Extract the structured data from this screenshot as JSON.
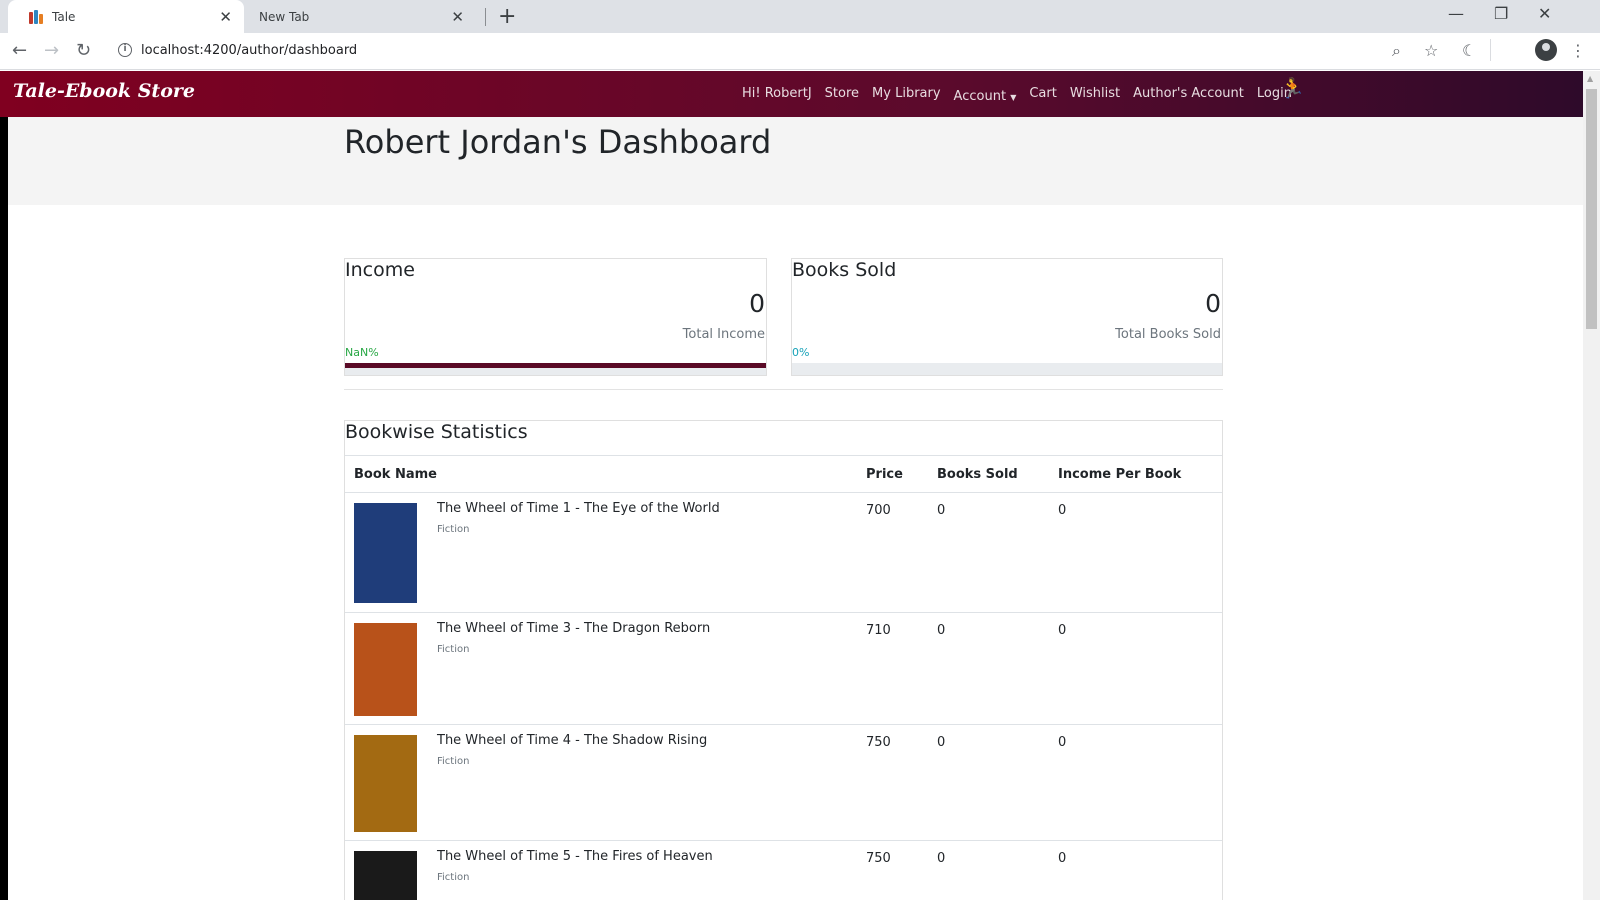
{
  "browser": {
    "tabs": [
      {
        "label": "Tale",
        "active": true
      },
      {
        "label": "New Tab",
        "active": false
      }
    ],
    "url": "localhost:4200/author/dashboard"
  },
  "navbar": {
    "brand": "Tale-Ebook Store",
    "greeting": "Hi! RobertJ",
    "links": [
      "Store",
      "My Library",
      "Account",
      "Cart",
      "Wishlist",
      "Author's Account",
      "Login"
    ]
  },
  "page_title": "Robert Jordan's Dashboard",
  "income": {
    "title": "Income",
    "value": "0",
    "label": "Total Income",
    "percent_text": "NaN%",
    "percent_color": "#28a745",
    "fill": 1.0
  },
  "books_sold": {
    "title": "Books Sold",
    "value": "0",
    "label": "Total Books Sold",
    "percent_text": "0%",
    "percent_color": "#17a2b8",
    "fill": 0
  },
  "bookwise": {
    "title": "Bookwise Statistics",
    "headers": [
      "Book Name",
      "Price",
      "Books Sold",
      "Income Per Book"
    ],
    "rows": [
      {
        "name": "The Wheel of Time 1 - The Eye of the World",
        "genre": "Fiction",
        "price": "700",
        "sold": "0",
        "income": "0",
        "cover_color": "#1f3d7a"
      },
      {
        "name": "The Wheel of Time 3 - The Dragon Reborn",
        "genre": "Fiction",
        "price": "710",
        "sold": "0",
        "income": "0",
        "cover_color": "#b8521a"
      },
      {
        "name": "The Wheel of Time 4 - The Shadow Rising",
        "genre": "Fiction",
        "price": "750",
        "sold": "0",
        "income": "0",
        "cover_color": "#a36a12"
      },
      {
        "name": "The Wheel of Time 5 - The Fires of Heaven",
        "genre": "Fiction",
        "price": "750",
        "sold": "0",
        "income": "0",
        "cover_color": "#1a1a1a"
      }
    ]
  }
}
